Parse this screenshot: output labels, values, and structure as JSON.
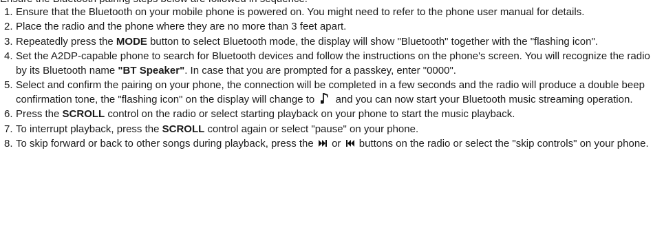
{
  "intro_cut": "Ensure the Bluetooth pairing steps below are followed in sequence:",
  "steps": [
    {
      "num": "1.",
      "t1": "Ensure that the Bluetooth on your mobile phone is powered on. You might need to refer to the phone user manual for details."
    },
    {
      "num": "2.",
      "t1": "Place the radio and the phone where they are no more than 3 feet apart."
    },
    {
      "num": "3.",
      "t1": "Repeatedly press the ",
      "b1": "MODE",
      "t2": " button to select Bluetooth mode, the display will show \"Bluetooth\" together with the \"flashing icon\"."
    },
    {
      "num": "4.",
      "t1": "Set the A2DP-capable phone to search for Bluetooth devices and follow the instructions on the phone's screen. You will recognize the radio by its Bluetooth name ",
      "b1": "\"BT Speaker\"",
      "t2": ". In case that you are prompted for a passkey, enter \"0000\"."
    },
    {
      "num": "5.",
      "t1": "Select and confirm the pairing on your phone, the connection will be completed in a few seconds and the radio will produce a double beep confirmation tone, the \"flashing icon\" on the display will change to",
      "t2": "and you can now start your Bluetooth music streaming operation.",
      "icon": "music-note-icon"
    },
    {
      "num": "6.",
      "t1": "Press the ",
      "b1": "SCROLL",
      "t2": " control on the radio or select starting playback on your phone to start the music playback."
    },
    {
      "num": "7.",
      "t1": "To interrupt playback, press the ",
      "b1": "SCROLL",
      "t2": " control again or select \"pause\" on your phone."
    },
    {
      "num": "8.",
      "t1": "To skip forward or back to other songs during playback, press the",
      "t2": "or",
      "t3": "buttons on the radio or select the \"skip controls\" on your phone.",
      "icon_forward": "skip-forward-icon",
      "icon_back": "skip-back-icon"
    }
  ]
}
